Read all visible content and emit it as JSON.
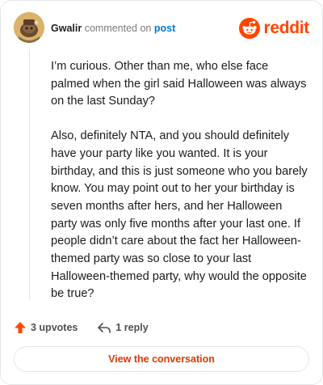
{
  "header": {
    "username": "Gwalir",
    "action_text": "commented on",
    "post_link": "post",
    "brand_name": "reddit",
    "brand_color": "#ff4500",
    "avatar_icon": "snoo-avatar-icon"
  },
  "comment": {
    "paragraphs": [
      "I’m curious. Other than me, who else face palmed when the girl said Halloween was always on the last Sunday?",
      "Also, definitely NTA, and you should definitely have your party like you wanted. It is your birthday, and this is just someone who you barely know. You may point out to her your birthday is seven months after hers, and her Halloween party was only five months after your last one. If people didn’t care about the fact her Halloween-themed party was so close to your last Halloween-themed party, why would the opposite be true?"
    ]
  },
  "actions": {
    "upvotes_label": "3 upvotes",
    "upvote_icon": "upvote-arrow-icon",
    "upvote_color": "#ff4500",
    "reply_label": "1 reply",
    "reply_icon": "reply-arrow-icon"
  },
  "cta": {
    "label": "View the conversation",
    "color": "#d93a00"
  }
}
